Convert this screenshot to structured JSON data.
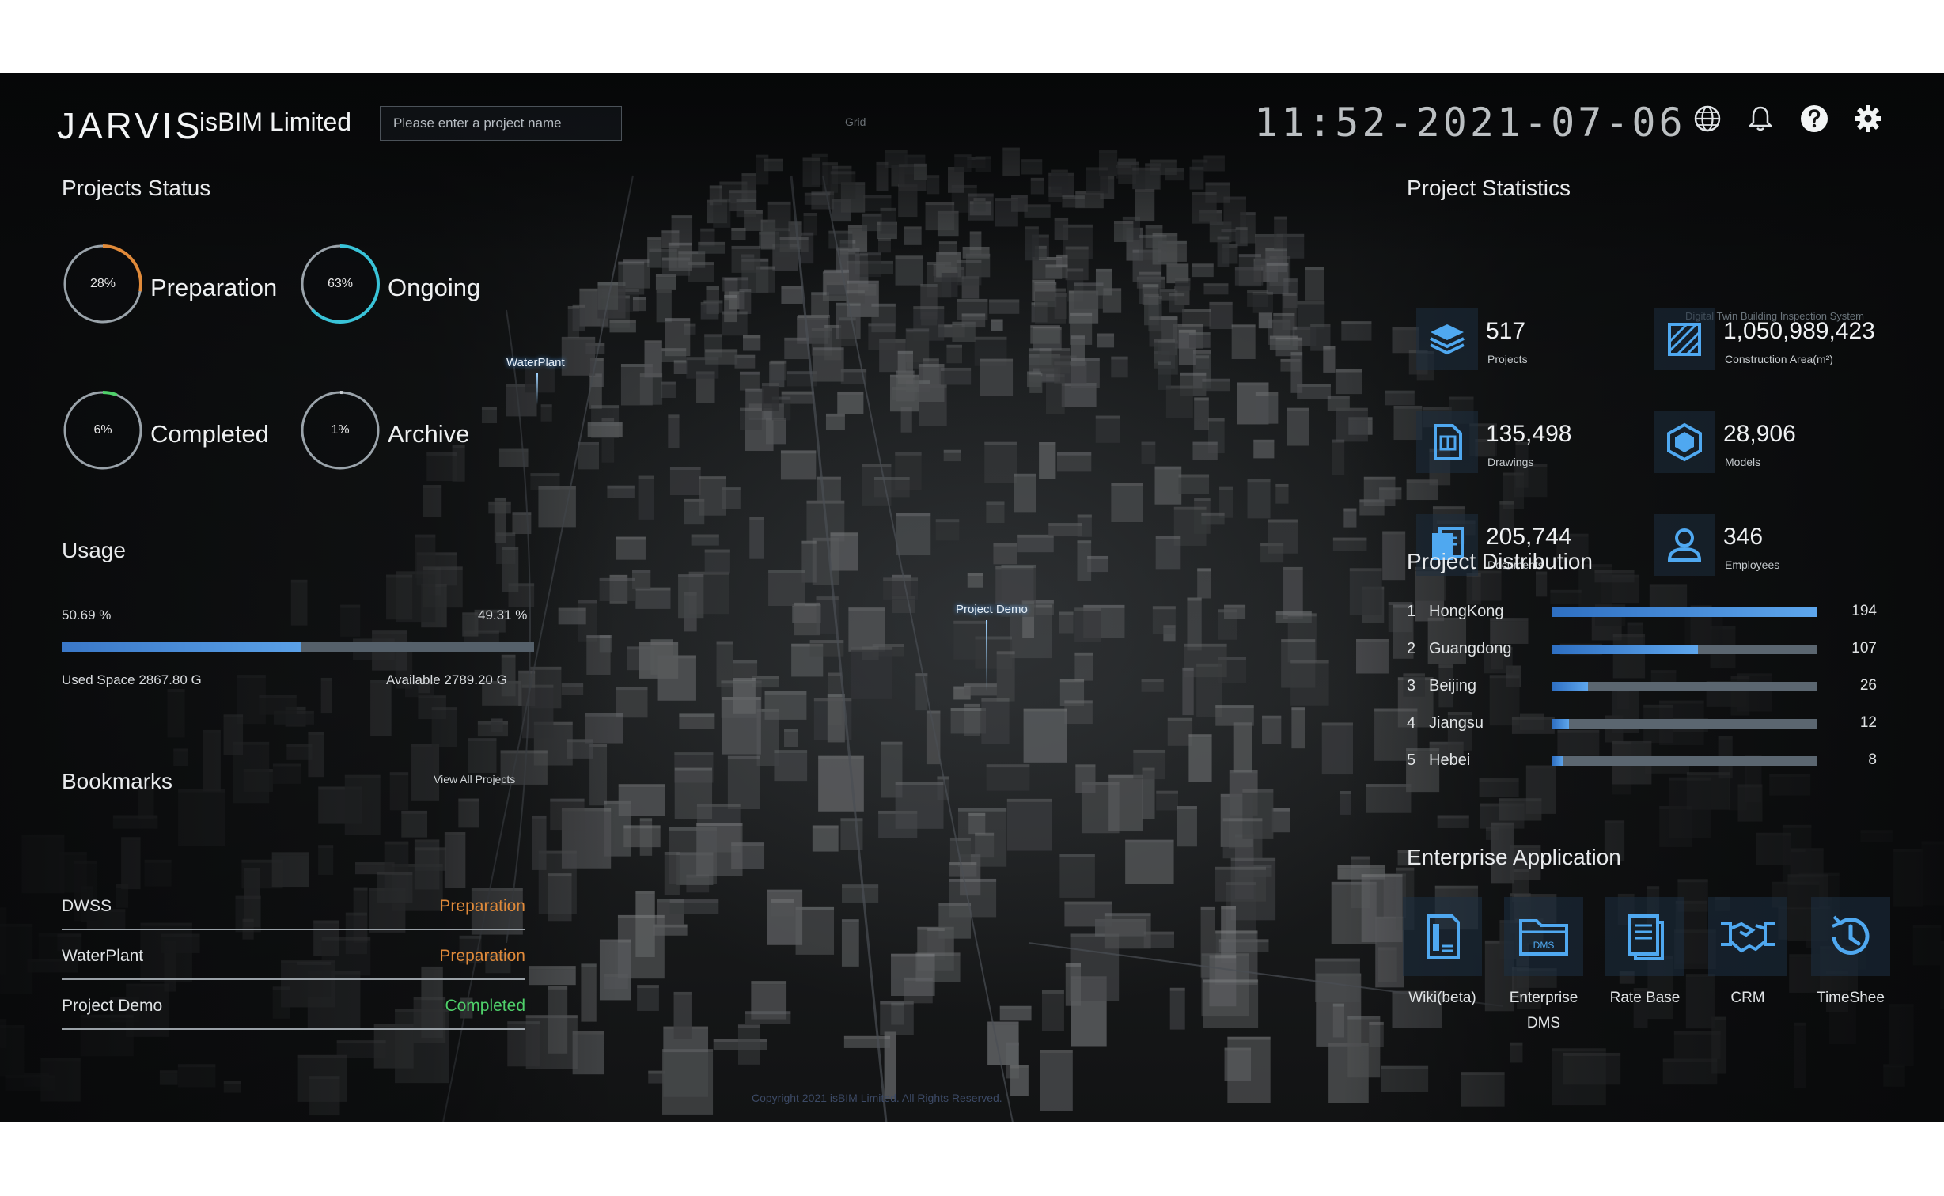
{
  "header": {
    "logo": "JARVIS",
    "company": "isBIM Limited",
    "search_placeholder": "Please enter a project name",
    "mid_caption": "Grid",
    "clock": "11:52-2021-07-06"
  },
  "projects_status": {
    "title": "Projects Status",
    "items": [
      {
        "pct": "28%",
        "label": "Preparation",
        "value": 0.28,
        "color": "#e08a3a"
      },
      {
        "pct": "63%",
        "label": "Ongoing",
        "value": 0.63,
        "color": "#39c3d8"
      },
      {
        "pct": "6%",
        "label": "Completed",
        "value": 0.06,
        "color": "#4fd06a"
      },
      {
        "pct": "1%",
        "label": "Archive",
        "value": 0.01,
        "color": "#c9ced3"
      }
    ]
  },
  "usage": {
    "title": "Usage",
    "used_pct": "50.69 %",
    "available_pct": "49.31 %",
    "used_fraction": 0.5069,
    "used_space": "Used Space  2867.80 G",
    "available": "Available  2789.20 G"
  },
  "bookmarks": {
    "title": "Bookmarks",
    "view_all": "View All Projects",
    "items": [
      {
        "name": "DWSS",
        "status": "Preparation",
        "color": "#e08a3a"
      },
      {
        "name": "WaterPlant",
        "status": "Preparation",
        "color": "#e08a3a"
      },
      {
        "name": "Project Demo",
        "status": "Completed",
        "color": "#4fd06a"
      }
    ]
  },
  "project_statistics": {
    "title": "Project Statistics",
    "extra_note": "Digital Twin Building Inspection System",
    "items": [
      {
        "value": "517",
        "label": "Projects",
        "icon": "layers-icon"
      },
      {
        "value": "1,050,989,423",
        "label": "Construction Area(m²)",
        "icon": "area-icon"
      },
      {
        "value": "135,498",
        "label": "Drawings",
        "icon": "drawing-icon"
      },
      {
        "value": "28,906",
        "label": "Models",
        "icon": "cube-icon"
      },
      {
        "value": "205,744",
        "label": "Documents",
        "icon": "documents-icon"
      },
      {
        "value": "346",
        "label": "Employees",
        "icon": "user-icon"
      }
    ]
  },
  "project_distribution": {
    "title": "Project Distribution",
    "items": [
      {
        "rank": "1",
        "name": "HongKong",
        "value": 194
      },
      {
        "rank": "2",
        "name": "Guangdong",
        "value": 107
      },
      {
        "rank": "3",
        "name": "Beijing",
        "value": 26
      },
      {
        "rank": "4",
        "name": "Jiangsu",
        "value": 12
      },
      {
        "rank": "5",
        "name": "Hebei",
        "value": 8
      }
    ],
    "max": 194
  },
  "enterprise_application": {
    "title": "Enterprise Application",
    "apps": [
      {
        "label": "Wiki(beta)",
        "icon": "wiki-icon"
      },
      {
        "label": "Enterprise DMS",
        "icon": "dms-folder-icon",
        "icon_text": "DMS"
      },
      {
        "label": "Rate Base",
        "icon": "rate-base-icon"
      },
      {
        "label": "CRM",
        "icon": "handshake-icon"
      },
      {
        "label": "TimeShee",
        "icon": "clock-icon"
      }
    ]
  },
  "map_pins": [
    {
      "label": "WaterPlant"
    },
    {
      "label": "Project Demo"
    }
  ],
  "footer_note": "Copyright 2021 isBIM Limited. All Rights Reserved."
}
